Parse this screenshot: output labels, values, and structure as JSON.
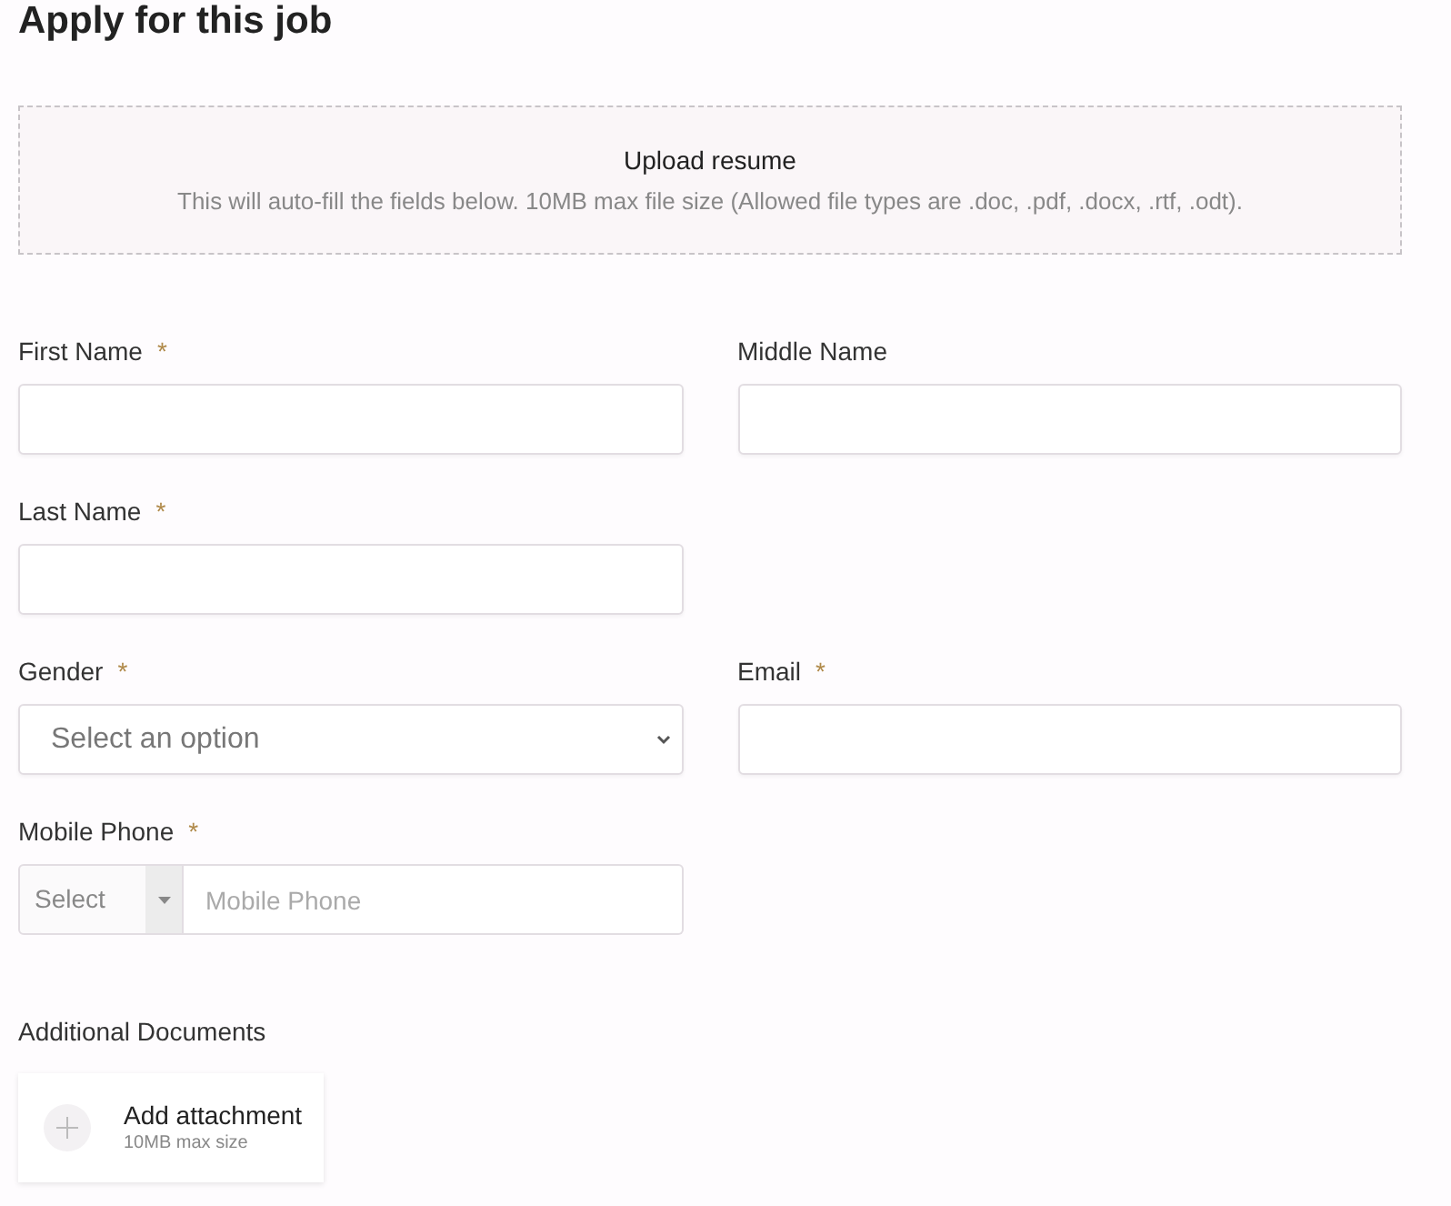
{
  "heading": "Apply for this job",
  "upload": {
    "title": "Upload resume",
    "hint": "This will auto-fill the fields below. 10MB max file size (Allowed file types are .doc, .pdf, .docx, .rtf, .odt)."
  },
  "rows": [
    [
      {
        "kind": "text",
        "label": "First Name",
        "required_mark": "*"
      },
      {
        "kind": "text",
        "label": "Middle Name"
      }
    ],
    [
      {
        "kind": "text",
        "label": "Last Name",
        "required_mark": "*"
      }
    ],
    [
      {
        "kind": "select",
        "label": "Gender",
        "required_mark": "*",
        "placeholder": "Select an option"
      },
      {
        "kind": "text",
        "label": "Email",
        "required_mark": "*"
      }
    ],
    [
      {
        "kind": "phone",
        "label": "Mobile Phone",
        "required_mark": "*",
        "code_placeholder": "Select",
        "placeholder": "Mobile Phone"
      }
    ]
  ],
  "documents": {
    "label": "Additional Documents",
    "button": "Add attachment",
    "hint": "10MB max size"
  }
}
